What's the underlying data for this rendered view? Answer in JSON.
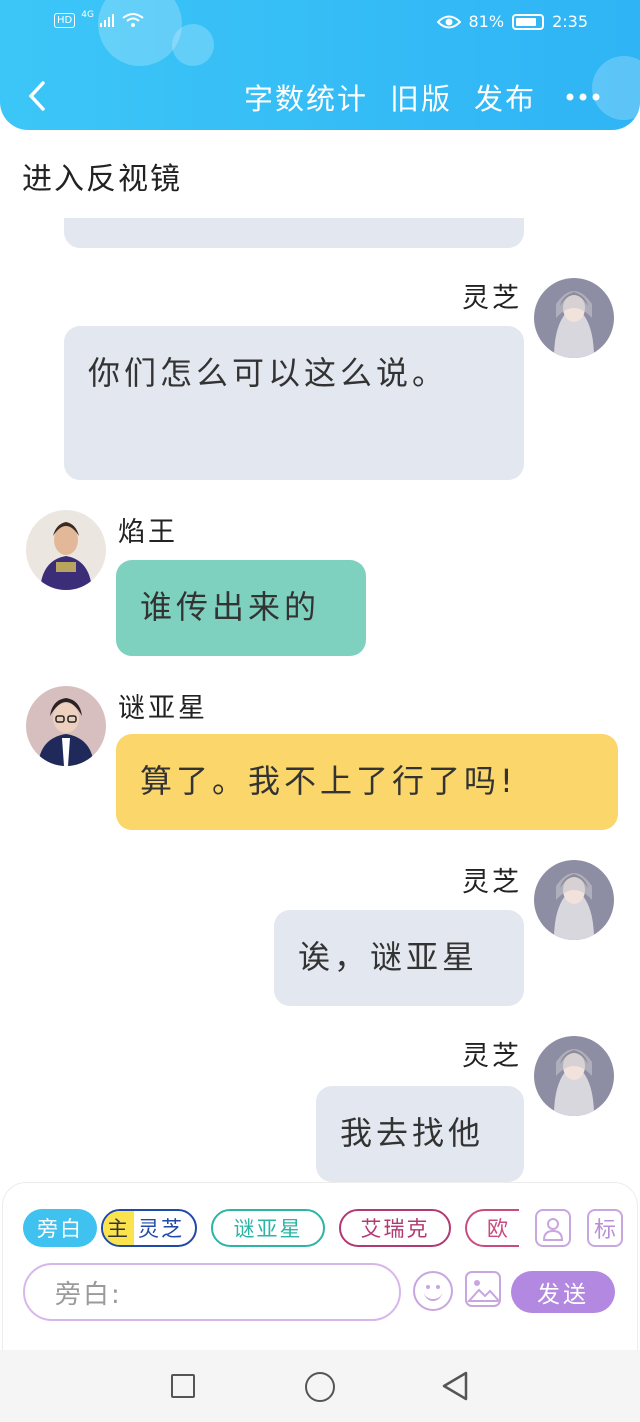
{
  "status_bar": {
    "hd": "HD",
    "network": "4G",
    "battery_percent": "81%",
    "battery_level": 0.81,
    "time": "2:35"
  },
  "header": {
    "actions": [
      "字数统计",
      "旧版",
      "发布"
    ]
  },
  "chapter": {
    "title": "进入反视镜"
  },
  "messages": [
    {
      "sender": "灵芝",
      "side": "right",
      "text": "你们怎么可以这么说。",
      "bubble_color": "#e3e7ef"
    },
    {
      "sender": "焰王",
      "side": "left",
      "text": "谁传出来的",
      "bubble_color": "#7ed1bf"
    },
    {
      "sender": "谜亚星",
      "side": "left",
      "text": "算了。我不上了行了吗!",
      "bubble_color": "#fbd66a"
    },
    {
      "sender": "灵芝",
      "side": "right",
      "text": "诶，谜亚星",
      "bubble_color": "#e3e7ef"
    },
    {
      "sender": "灵芝",
      "side": "right",
      "text": "我去找他",
      "bubble_color": "#e3e7ef"
    }
  ],
  "role_chips": {
    "narration": "旁白",
    "main_tag": "主",
    "lingzhi": "灵芝",
    "miyaxing": "谜亚星",
    "arc": "艾瑞克",
    "ou": "欧 "
  },
  "toolbar_icons": {
    "label_icon": "标"
  },
  "input": {
    "value": "旁白:"
  },
  "send_label": "发送",
  "colors": {
    "header": "#35bcf6",
    "send": "#b388e0",
    "narration_chip": "#3fc2f0"
  }
}
